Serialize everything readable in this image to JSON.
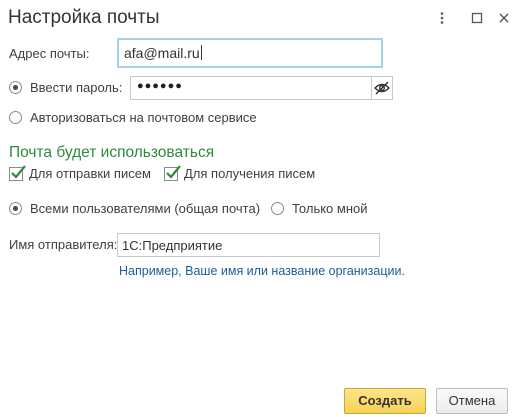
{
  "window": {
    "title": "Настройка почты",
    "menu_icon": "more-vertical-icon",
    "maximize_icon": "maximize-icon",
    "close_icon": "close-icon"
  },
  "email": {
    "label": "Адрес почты:",
    "value": "afa@mail.ru"
  },
  "auth": {
    "password_option_label": "Ввести пароль:",
    "password_option_selected": true,
    "password_value": "●●●●●●",
    "show_password_icon": "eye-off-icon",
    "service_option_label": "Авторизоваться на почтовом сервисе",
    "service_option_selected": false
  },
  "usage": {
    "section_title": "Почта будет использоваться",
    "send_label": "Для отправки писем",
    "send_checked": true,
    "receive_label": "Для получения писем",
    "receive_checked": true,
    "all_users_label": "Всеми пользователями (общая почта)",
    "all_users_selected": true,
    "only_me_label": "Только мной",
    "only_me_selected": false
  },
  "sender": {
    "label": "Имя отправителя:",
    "value": "1С:Предприятие",
    "hint": "Например, Ваше имя или название организации."
  },
  "footer": {
    "create_label": "Создать",
    "cancel_label": "Отмена"
  },
  "colors": {
    "accent_green": "#2e8b3a",
    "hint_blue": "#1f5c99",
    "focus_border": "#a6d3ea",
    "primary_button": "#f7d155"
  }
}
